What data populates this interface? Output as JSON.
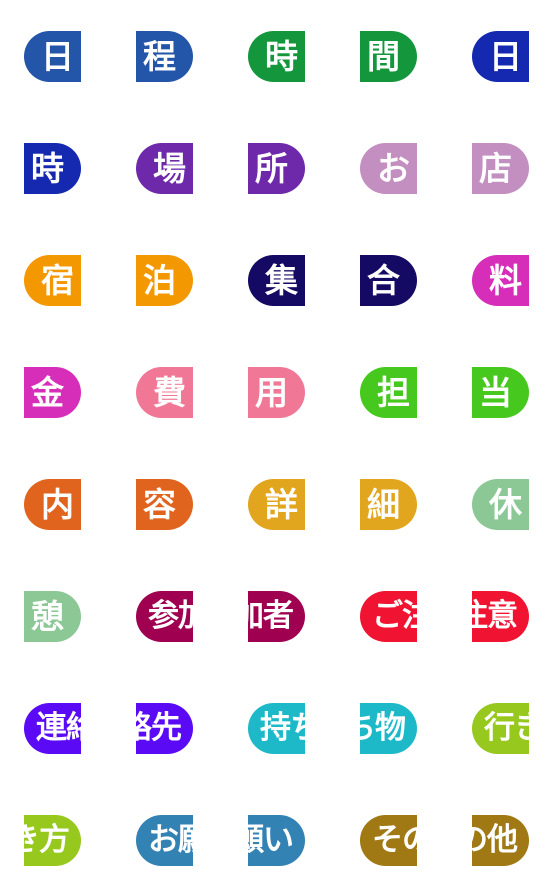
{
  "stickers": [
    {
      "chars": [
        "日",
        "程"
      ],
      "word": "日程",
      "mode": "per-char",
      "color": "#2356a8"
    },
    {
      "chars": [
        "時",
        "間"
      ],
      "word": "時間",
      "mode": "per-char",
      "color": "#14963c"
    },
    {
      "chars": [
        "日",
        "時"
      ],
      "word": "日時",
      "mode": "per-char",
      "color": "#1428b0"
    },
    {
      "chars": [
        "場",
        "所"
      ],
      "word": "場所",
      "mode": "per-char",
      "color": "#6e28aa"
    },
    {
      "chars": [
        "お",
        "店"
      ],
      "word": "お店",
      "mode": "per-char",
      "color": "#c38ec0"
    },
    {
      "chars": [
        "宿",
        "泊"
      ],
      "word": "宿泊",
      "mode": "per-char",
      "color": "#f39800"
    },
    {
      "chars": [
        "集",
        "合"
      ],
      "word": "集合",
      "mode": "per-char",
      "color": "#140a64"
    },
    {
      "chars": [
        "料",
        "金"
      ],
      "word": "料金",
      "mode": "per-char",
      "color": "#d72eb9"
    },
    {
      "chars": [
        "費",
        "用"
      ],
      "word": "費用",
      "mode": "per-char",
      "color": "#f07896"
    },
    {
      "chars": [
        "担",
        "当"
      ],
      "word": "担当",
      "mode": "per-char",
      "color": "#46c81e"
    },
    {
      "chars": [
        "内",
        "容"
      ],
      "word": "内容",
      "mode": "per-char",
      "color": "#e1641e"
    },
    {
      "chars": [
        "詳",
        "細"
      ],
      "word": "詳細",
      "mode": "per-char",
      "color": "#e1a51e"
    },
    {
      "chars": [
        "休",
        "憩"
      ],
      "word": "休憩",
      "mode": "per-char",
      "color": "#8cc896"
    },
    {
      "chars": [],
      "word": "参加者",
      "mode": "span",
      "color": "#a00050"
    },
    {
      "chars": [],
      "word": "ご注意",
      "mode": "span",
      "color": "#f01432"
    },
    {
      "chars": [],
      "word": "連絡先",
      "mode": "span",
      "color": "#5a0af5"
    },
    {
      "chars": [],
      "word": "持ち物",
      "mode": "span",
      "color": "#1eb9c8"
    },
    {
      "chars": [],
      "word": "行き方",
      "mode": "span",
      "color": "#96c81e"
    },
    {
      "chars": [],
      "word": "お願い",
      "mode": "span",
      "color": "#3282b4"
    },
    {
      "chars": [],
      "word": "その他",
      "mode": "span",
      "color": "#a07814"
    }
  ]
}
